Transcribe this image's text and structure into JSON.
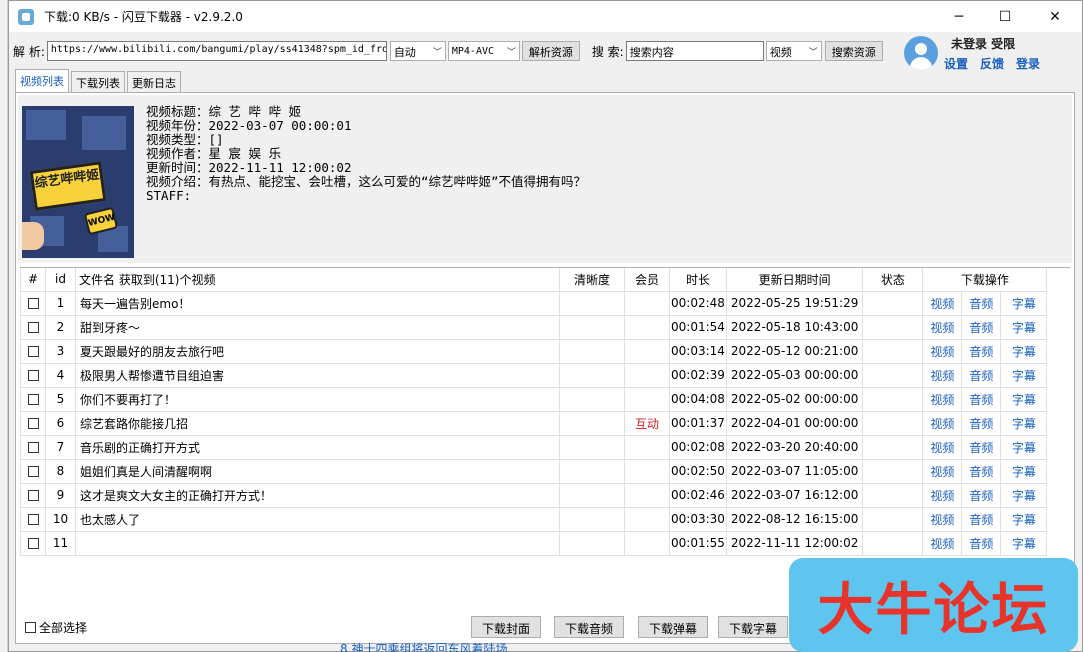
{
  "titlebar": {
    "title": "下载:0 KB/s - 闪豆下载器 - v2.9.2.0",
    "minimize": "─",
    "maximize": "☐",
    "close": "✕"
  },
  "toolbar": {
    "parse_label": "解 析:",
    "url_value": "https://www.bilibili.com/bangumi/play/ss41348?spm_id_fro",
    "quality_select": "自动",
    "format_select": "MP4-AVC",
    "parse_button": "解析资源",
    "search_label": "搜 索:",
    "search_value": "搜索内容",
    "search_type": "视频",
    "search_button": "搜索资源"
  },
  "user": {
    "status": "未登录  受限",
    "settings": "设置",
    "feedback": "反馈",
    "login": "登录",
    "avatar_icon": "user-icon"
  },
  "tabs": [
    "视频列表",
    "下载列表",
    "更新日志"
  ],
  "video_info": {
    "cover_text": "综艺哔哔姬",
    "cover_sticker": "WOW",
    "lines": [
      "视频标题：综 艺 哔 哔 姬",
      "视频年份：2022-03-07 00:00:01",
      "视频类型：[]",
      "视频作者：星 宸 娱 乐",
      "更新时间：2022-11-11 12:00:02",
      "视频介绍：有热点、能挖宝、会吐槽，这么可爱的“综艺哔哔姬”不值得拥有吗？",
      "STAFF:"
    ]
  },
  "table": {
    "headers": {
      "check": "#",
      "id": "id",
      "filename": "文件名       获取到(11)个视频",
      "quality": "清晰度",
      "vip": "会员",
      "duration": "时长",
      "updated": "更新日期时间",
      "status": "状态",
      "actions": "下载操作"
    },
    "action_labels": {
      "video": "视频",
      "audio": "音频",
      "subtitle": "字幕"
    },
    "rows": [
      {
        "id": "1",
        "name": "每天一遍告别emo！",
        "quality": "",
        "vip": "",
        "duration": "00:02:48",
        "updated": "2022-05-25 19:51:29",
        "status": ""
      },
      {
        "id": "2",
        "name": "甜到牙疼～",
        "quality": "",
        "vip": "",
        "duration": "00:01:54",
        "updated": "2022-05-18 10:43:00",
        "status": ""
      },
      {
        "id": "3",
        "name": "夏天跟最好的朋友去旅行吧",
        "quality": "",
        "vip": "",
        "duration": "00:03:14",
        "updated": "2022-05-12 00:21:00",
        "status": ""
      },
      {
        "id": "4",
        "name": "极限男人帮惨遭节目组迫害",
        "quality": "",
        "vip": "",
        "duration": "00:02:39",
        "updated": "2022-05-03 00:00:00",
        "status": ""
      },
      {
        "id": "5",
        "name": "你们不要再打了！",
        "quality": "",
        "vip": "",
        "duration": "00:04:08",
        "updated": "2022-05-02 00:00:00",
        "status": ""
      },
      {
        "id": "6",
        "name": "综艺套路你能接几招",
        "quality": "",
        "vip": "互动",
        "duration": "00:01:37",
        "updated": "2022-04-01 00:00:00",
        "status": ""
      },
      {
        "id": "7",
        "name": "音乐剧的正确打开方式",
        "quality": "",
        "vip": "",
        "duration": "00:02:08",
        "updated": "2022-03-20 20:40:00",
        "status": ""
      },
      {
        "id": "8",
        "name": "姐姐们真是人间清醒啊啊",
        "quality": "",
        "vip": "",
        "duration": "00:02:50",
        "updated": "2022-03-07 11:05:00",
        "status": ""
      },
      {
        "id": "9",
        "name": "这才是爽文大女主的正确打开方式！",
        "quality": "",
        "vip": "",
        "duration": "00:02:46",
        "updated": "2022-03-07 16:12:00",
        "status": ""
      },
      {
        "id": "10",
        "name": "也太感人了",
        "quality": "",
        "vip": "",
        "duration": "00:03:30",
        "updated": "2022-08-12 16:15:00",
        "status": ""
      },
      {
        "id": "11",
        "name": "",
        "quality": "",
        "vip": "",
        "duration": "00:01:55",
        "updated": "2022-11-11 12:00:02",
        "status": ""
      }
    ]
  },
  "bottom": {
    "select_all": "全部选择",
    "buttons": [
      "下载封面",
      "下载音频",
      "下载弹幕",
      "下载字幕"
    ]
  },
  "watermark": "大牛论坛",
  "background_text": "8   神十四乘组将返回东风着陆场",
  "colors": {
    "link": "#1a5fbf",
    "red": "#d02020",
    "watermark_bg": "#5ec6ee",
    "watermark_text": "#e8332a"
  }
}
